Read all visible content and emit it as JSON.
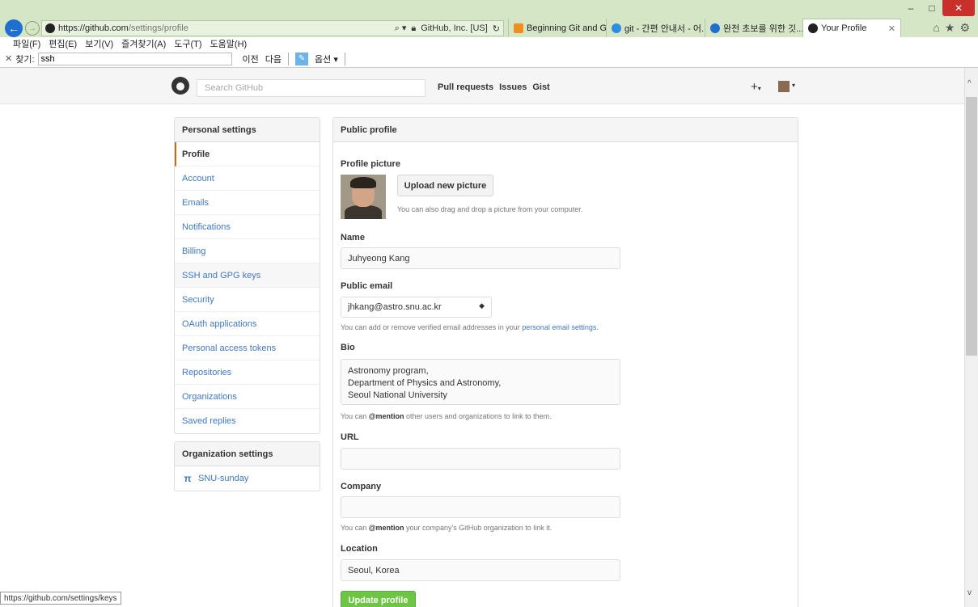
{
  "browser": {
    "url_host": "https://github.com",
    "url_path": "/settings/profile",
    "security_label": "GitHub, Inc. [US]",
    "tabs": [
      {
        "label": "Beginning Git and Git...",
        "color": "#f28c1b"
      },
      {
        "label": "git - 간편 안내서 - 어...",
        "color": "#2d8de0"
      },
      {
        "label": "완전 초보를 위한 깃...",
        "color": "#1f6fd1"
      },
      {
        "label": "Your Profile",
        "color": "#222222"
      }
    ],
    "menu": [
      "파일(F)",
      "편집(E)",
      "보기(V)",
      "즐겨찾기(A)",
      "도구(T)",
      "도움말(H)"
    ],
    "find": {
      "label": "찾기:",
      "value": "ssh",
      "prev": "이전",
      "next": "다음",
      "options": "옵션"
    },
    "status_url": "https://github.com/settings/keys"
  },
  "header": {
    "search_placeholder": "Search GitHub",
    "nav": [
      "Pull requests",
      "Issues",
      "Gist"
    ]
  },
  "sidebar": {
    "title": "Personal settings",
    "items": [
      {
        "label": "Profile",
        "selected": true
      },
      {
        "label": "Account"
      },
      {
        "label": "Emails"
      },
      {
        "label": "Notifications"
      },
      {
        "label": "Billing"
      },
      {
        "label": "SSH and GPG keys",
        "hovered": true
      },
      {
        "label": "Security"
      },
      {
        "label": "OAuth applications"
      },
      {
        "label": "Personal access tokens"
      },
      {
        "label": "Repositories"
      },
      {
        "label": "Organizations"
      },
      {
        "label": "Saved replies"
      }
    ],
    "org_title": "Organization settings",
    "org_item": "SNU-sunday"
  },
  "profile": {
    "panel_title": "Public profile",
    "picture_label": "Profile picture",
    "upload_button": "Upload new picture",
    "upload_hint": "You can also drag and drop a picture from your computer.",
    "name_label": "Name",
    "name_value": "Juhyeong Kang",
    "email_label": "Public email",
    "email_value": "jhkang@astro.snu.ac.kr",
    "email_hint_pre": "You can add or remove verified email addresses in your ",
    "email_hint_link": "personal email settings.",
    "bio_label": "Bio",
    "bio_lines": [
      "Astronomy program,",
      "Department of Physics and Astronomy,",
      "Seoul National University"
    ],
    "bio_hint_pre": "You can ",
    "bio_hint_bold": "@mention",
    "bio_hint_post": " other users and organizations to link to them.",
    "url_label": "URL",
    "url_value": "",
    "company_label": "Company",
    "company_value": "",
    "company_hint_pre": "You can ",
    "company_hint_bold": "@mention",
    "company_hint_post": " your company's GitHub organization to link it.",
    "location_label": "Location",
    "location_value": "Seoul, Korea",
    "update_button": "Update profile"
  }
}
